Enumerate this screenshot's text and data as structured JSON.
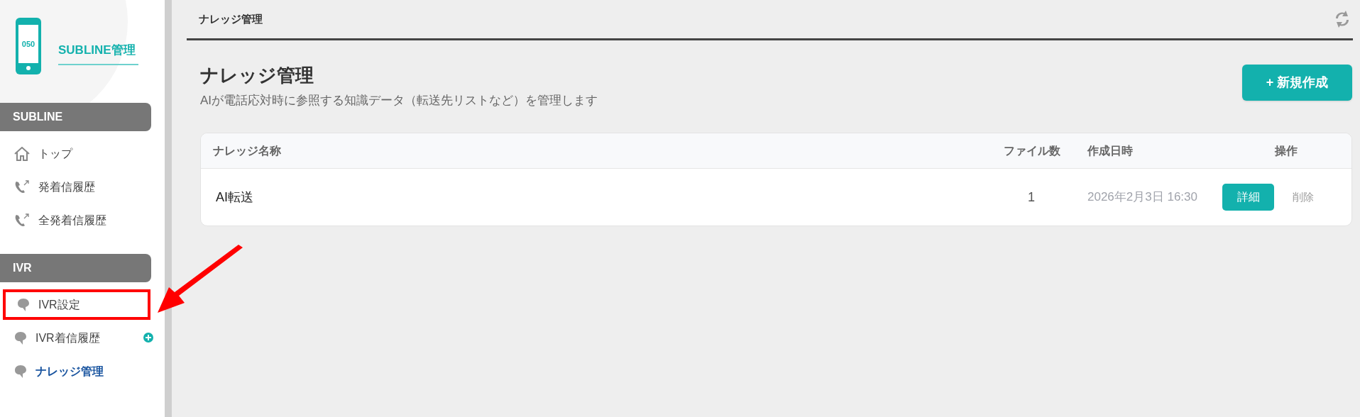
{
  "header": {
    "title": "ナレッジ管理"
  },
  "sidebar": {
    "logo": {
      "number": "050",
      "title": "SUBLINE管理"
    },
    "sections": [
      {
        "title": "SUBLINE",
        "items": [
          {
            "label": "トップ",
            "kind": "home",
            "selected": false,
            "highlighted": false
          },
          {
            "label": "発着信履歴",
            "kind": "call",
            "selected": false,
            "highlighted": false
          },
          {
            "label": "全発着信履歴",
            "kind": "call",
            "selected": false,
            "highlighted": false
          }
        ]
      },
      {
        "title": "IVR",
        "items": [
          {
            "label": "IVR設定",
            "kind": "bubble",
            "selected": false,
            "highlighted": true
          },
          {
            "label": "IVR着信履歴",
            "kind": "bubble",
            "selected": false,
            "highlighted": false,
            "badge": true
          },
          {
            "label": "ナレッジ管理",
            "kind": "bubble",
            "selected": true,
            "highlighted": false
          }
        ]
      }
    ]
  },
  "page": {
    "title": "ナレッジ管理",
    "subtitle": "AIが電話応対時に参照する知識データ（転送先リストなど）を管理します",
    "new_button": "+ 新規作成"
  },
  "table": {
    "columns": [
      "ナレッジ名称",
      "ファイル数",
      "作成日時",
      "操作"
    ],
    "rows": [
      {
        "name": "AI転送",
        "files": "1",
        "created": "2026年2月3日 16:30",
        "detail": "詳細",
        "delete": "削除"
      }
    ]
  }
}
